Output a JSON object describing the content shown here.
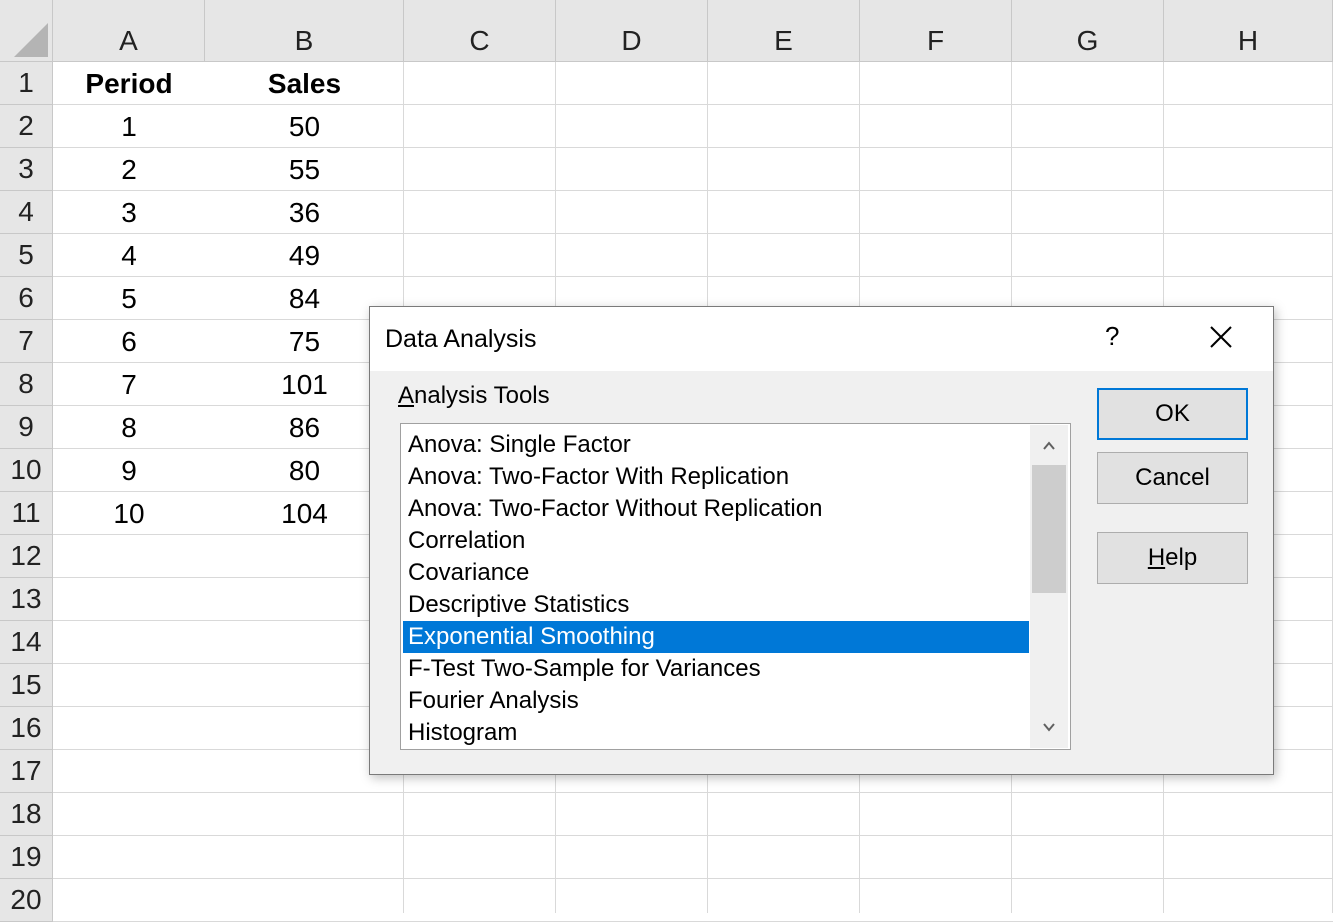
{
  "sheet": {
    "columns": [
      "A",
      "B",
      "C",
      "D",
      "E",
      "F",
      "G",
      "H"
    ],
    "rows": [
      "1",
      "2",
      "3",
      "4",
      "5",
      "6",
      "7",
      "8",
      "9",
      "10",
      "11",
      "12",
      "13",
      "14",
      "15",
      "16",
      "17",
      "18",
      "19",
      "20"
    ],
    "headers": {
      "period": "Period",
      "sales": "Sales"
    },
    "data": [
      {
        "period": "1",
        "sales": "50"
      },
      {
        "period": "2",
        "sales": "55"
      },
      {
        "period": "3",
        "sales": "36"
      },
      {
        "period": "4",
        "sales": "49"
      },
      {
        "period": "5",
        "sales": "84"
      },
      {
        "period": "6",
        "sales": "75"
      },
      {
        "period": "7",
        "sales": "101"
      },
      {
        "period": "8",
        "sales": "86"
      },
      {
        "period": "9",
        "sales": "80"
      },
      {
        "period": "10",
        "sales": "104"
      }
    ]
  },
  "dialog": {
    "title": "Data Analysis",
    "help_glyph": "?",
    "tools_label_first": "A",
    "tools_label_rest": "nalysis Tools",
    "tools": [
      "Anova: Single Factor",
      "Anova: Two-Factor With Replication",
      "Anova: Two-Factor Without Replication",
      "Correlation",
      "Covariance",
      "Descriptive Statistics",
      "Exponential Smoothing",
      "F-Test Two-Sample for Variances",
      "Fourier Analysis",
      "Histogram"
    ],
    "selected_tool": "Exponential Smoothing",
    "ok_label": "OK",
    "cancel_label": "Cancel",
    "help_label_first": "H",
    "help_label_rest": "elp"
  },
  "colors": {
    "selection": "#0078d7",
    "header_bg": "#e6e6e6",
    "dialog_bg": "#f0f0f0"
  }
}
